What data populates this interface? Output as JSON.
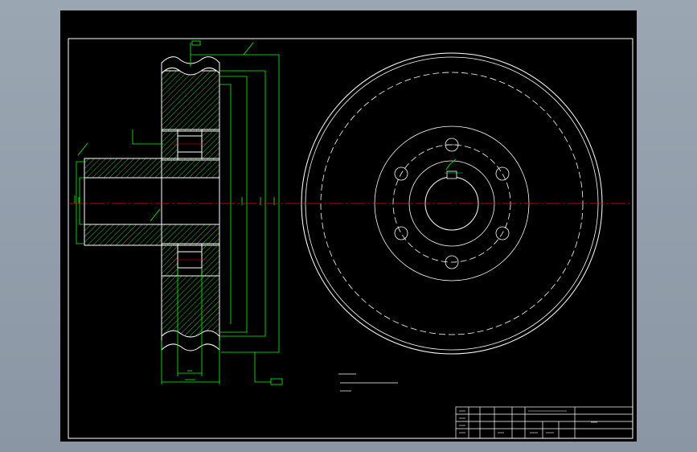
{
  "colors": {
    "background": "#000000",
    "frame": "#ffffff",
    "part_outline": "#ffffff",
    "hatch": "#3dbb3d",
    "dimension": "#00ff00",
    "centerline": "#ff0000",
    "dashed_circles": "#ffffff"
  },
  "icons": {
    "roughness_symbol": "roughness-check-icon"
  },
  "title_block": {
    "drawing_title": "",
    "scale": "",
    "material": ""
  }
}
